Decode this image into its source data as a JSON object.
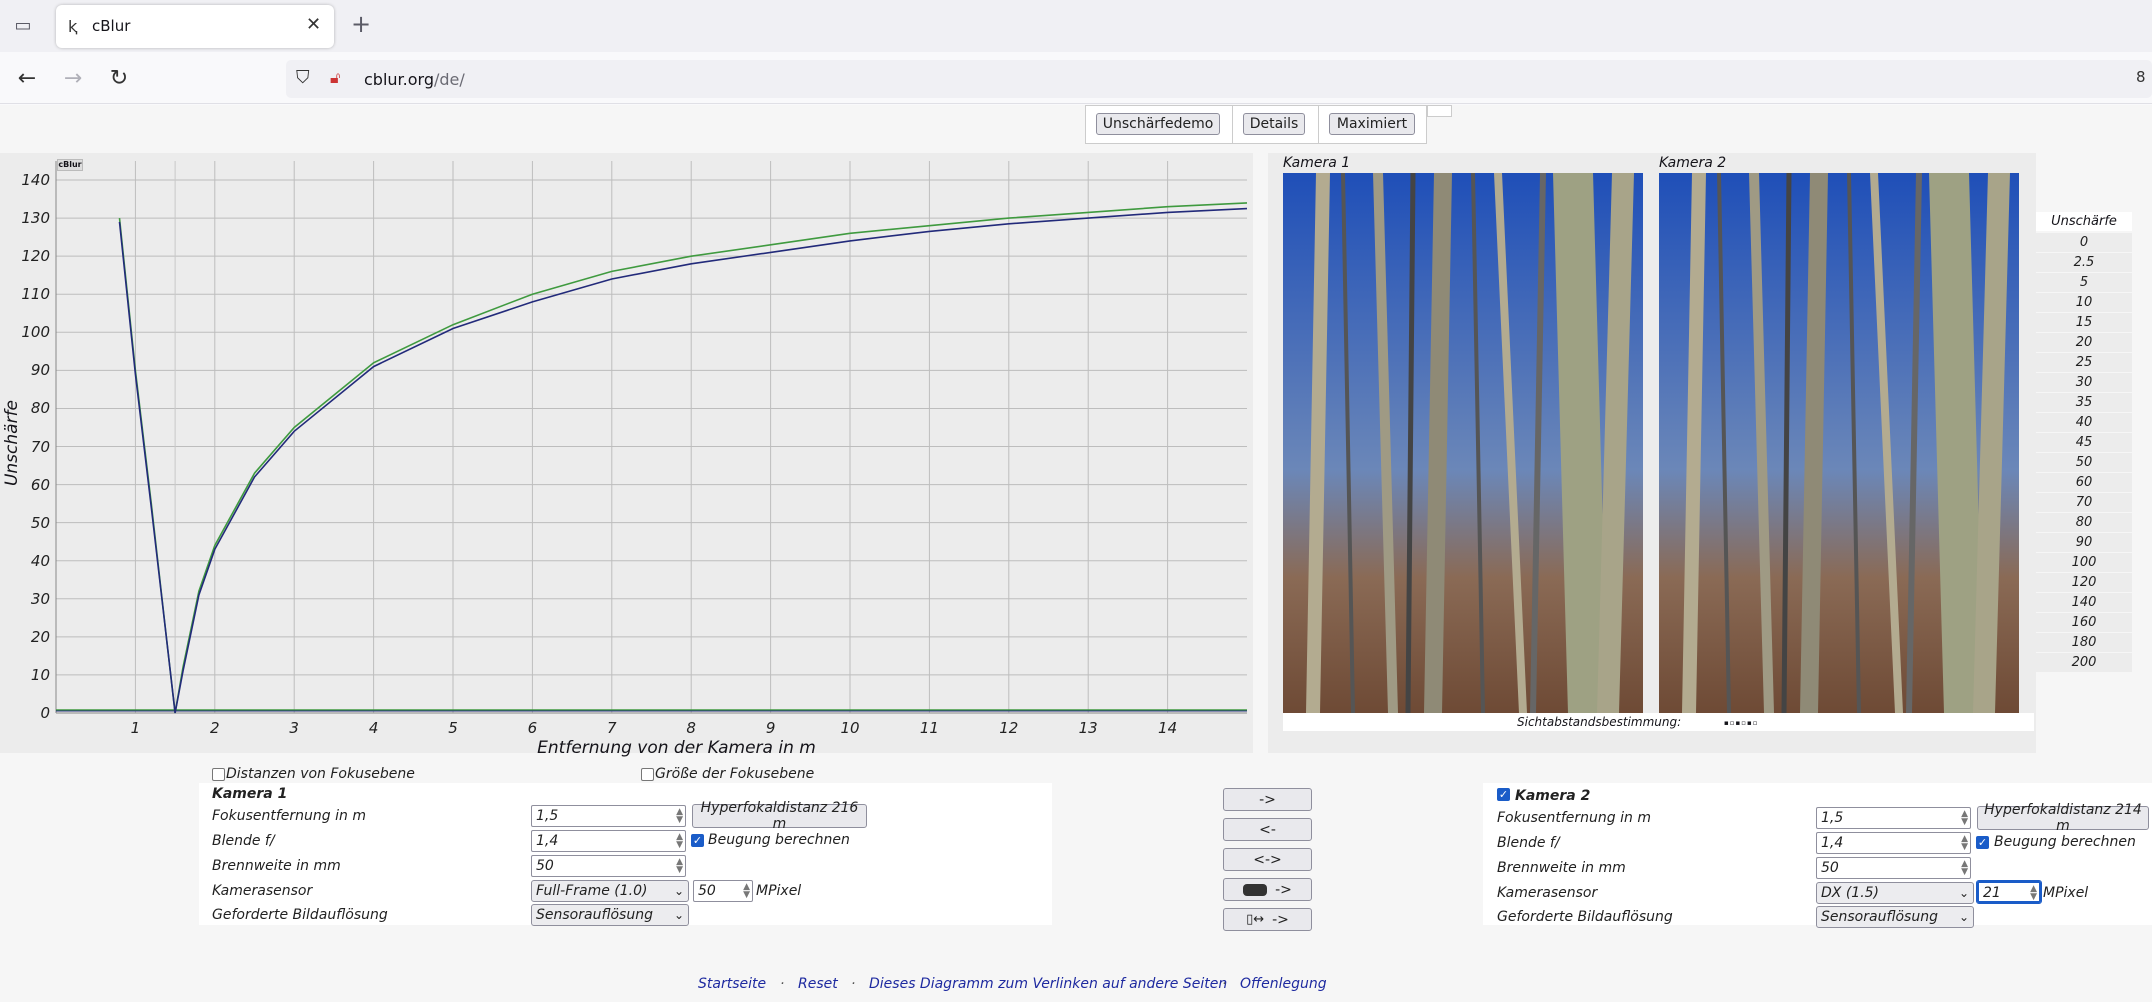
{
  "browser": {
    "tab_title": "cBlur",
    "url_host": "cblur.org",
    "url_path": "/de/",
    "edge_char": "8"
  },
  "top_buttons": [
    "Unschärfedemo",
    "Details",
    "Maximiert"
  ],
  "chart_data": {
    "type": "line",
    "corner_label": "cBlur",
    "xlabel": "Entfernung von der Kamera in m",
    "ylabel": "Unschärfe",
    "xlim": [
      0,
      15
    ],
    "ylim": [
      0,
      145
    ],
    "yticks": [
      0,
      10,
      20,
      30,
      40,
      50,
      60,
      70,
      80,
      90,
      100,
      110,
      120,
      130,
      140
    ],
    "xticks": [
      1,
      2,
      3,
      4,
      5,
      6,
      7,
      8,
      9,
      10,
      11,
      12,
      13,
      14
    ],
    "grid": true,
    "series": [
      {
        "color": "#3f9a3f",
        "x": [
          0.8,
          1.0,
          1.2,
          1.4,
          1.5,
          1.6,
          1.8,
          2.0,
          2.5,
          3.0,
          4.0,
          5.0,
          6.0,
          7.0,
          8.0,
          9.0,
          10.0,
          11.0,
          12.0,
          13.0,
          14.0,
          15.0
        ],
        "y": [
          130,
          90,
          55,
          18,
          0,
          12,
          32,
          44,
          63,
          75,
          92,
          102,
          110,
          116,
          120,
          123,
          126,
          128,
          130,
          131.5,
          133,
          134
        ]
      },
      {
        "color": "#222a7a",
        "x": [
          0.8,
          1.0,
          1.2,
          1.4,
          1.5,
          1.6,
          1.8,
          2.0,
          2.5,
          3.0,
          4.0,
          5.0,
          6.0,
          7.0,
          8.0,
          9.0,
          10.0,
          11.0,
          12.0,
          13.0,
          14.0,
          15.0
        ],
        "y": [
          129,
          89,
          54,
          18,
          0,
          11,
          31,
          43,
          62,
          74,
          91,
          101,
          108,
          114,
          118,
          121,
          124,
          126.5,
          128.5,
          130,
          131.5,
          132.5
        ]
      }
    ]
  },
  "cameras": {
    "cam1_title": "Kamera 1",
    "cam2_title": "Kamera 2",
    "sicht_label": "Sichtabstandsbestimmung:"
  },
  "legend": {
    "title": "Unschärfe",
    "values": [
      "0",
      "2.5",
      "5",
      "10",
      "15",
      "20",
      "25",
      "30",
      "35",
      "40",
      "45",
      "50",
      "60",
      "70",
      "80",
      "90",
      "100",
      "120",
      "140",
      "160",
      "180",
      "200"
    ]
  },
  "options": {
    "distanzen": "Distanzen von Fokusebene",
    "groesse": "Größe der Fokusebene"
  },
  "kamera1": {
    "title": "Kamera 1",
    "fokus_label": "Fokusentfernung in m",
    "fokus_value": "1,5",
    "hyper": "Hyperfokaldistanz 216 m",
    "blende_label": "Blende f/",
    "blende_value": "1,4",
    "beugung": "Beugung berechnen",
    "brenn_label": "Brennweite in mm",
    "brenn_value": "50",
    "sensor_label": "Kamerasensor",
    "sensor_value": "Full-Frame (1.0)",
    "mpix_value": "50",
    "mpix_label": "MPixel",
    "aufl_label": "Geforderte Bildauflösung",
    "aufl_value": "Sensorauflösung"
  },
  "kamera2": {
    "title": "Kamera 2",
    "fokus_label": "Fokusentfernung in m",
    "fokus_value": "1,5",
    "hyper": "Hyperfokaldistanz 214 m",
    "blende_label": "Blende f/",
    "blende_value": "1,4",
    "beugung": "Beugung berechnen",
    "brenn_label": "Brennweite in mm",
    "brenn_value": "50",
    "sensor_label": "Kamerasensor",
    "sensor_value": "DX (1.5)",
    "mpix_value": "21",
    "mpix_label": "MPixel",
    "aufl_label": "Geforderte Bildauflösung",
    "aufl_value": "Sensorauflösung"
  },
  "middle_buttons": [
    "->",
    "<-",
    "<->",
    "->",
    "->"
  ],
  "footer": {
    "links": [
      "Startseite",
      "Reset",
      "Dieses Diagramm zum Verlinken auf andere Seiten",
      "Offenlegung"
    ],
    "sep": "·"
  }
}
